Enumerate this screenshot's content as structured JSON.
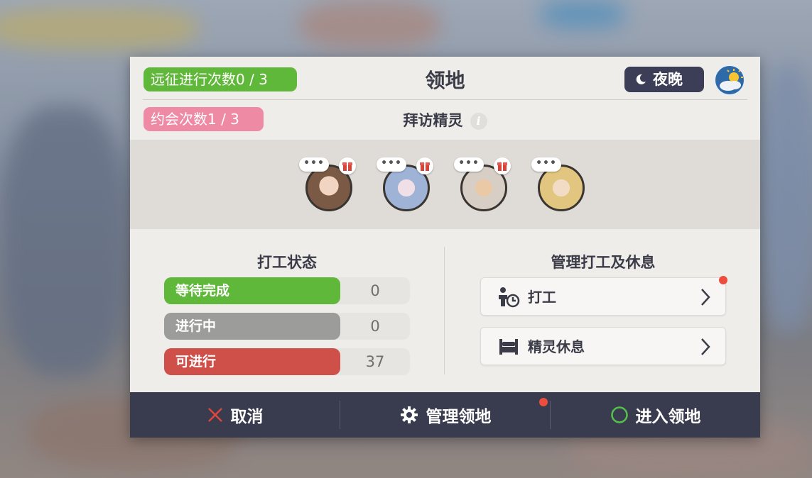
{
  "panel": {
    "title": "领地",
    "expedition_count": "远征进行次数0 / 3",
    "date_count": "约会次数1 / 3",
    "time_of_day": "夜晚",
    "visit_title": "拜访精灵",
    "info_glyph": "i",
    "bubble_text": "•••"
  },
  "spirits": [
    {
      "name": "spirit-1",
      "has_gift": true
    },
    {
      "name": "spirit-2",
      "has_gift": true
    },
    {
      "name": "spirit-3",
      "has_gift": true
    },
    {
      "name": "spirit-4",
      "has_gift": false
    }
  ],
  "work_status": {
    "title": "打工状态",
    "rows": [
      {
        "label": "等待完成",
        "count": "0",
        "color": "#5fb839"
      },
      {
        "label": "进行中",
        "count": "0",
        "color": "#9c9c9a"
      },
      {
        "label": "可进行",
        "count": "37",
        "color": "#cf5049"
      }
    ]
  },
  "manage": {
    "title": "管理打工及休息",
    "work_label": "打工",
    "rest_label": "精灵休息"
  },
  "footer": {
    "cancel": "取消",
    "manage": "管理领地",
    "enter": "进入领地"
  },
  "colors": {
    "accent_green": "#5fb839",
    "accent_pink": "#ef8aa5",
    "footer_bg": "#393b4f",
    "notification": "#ec4d3d"
  }
}
